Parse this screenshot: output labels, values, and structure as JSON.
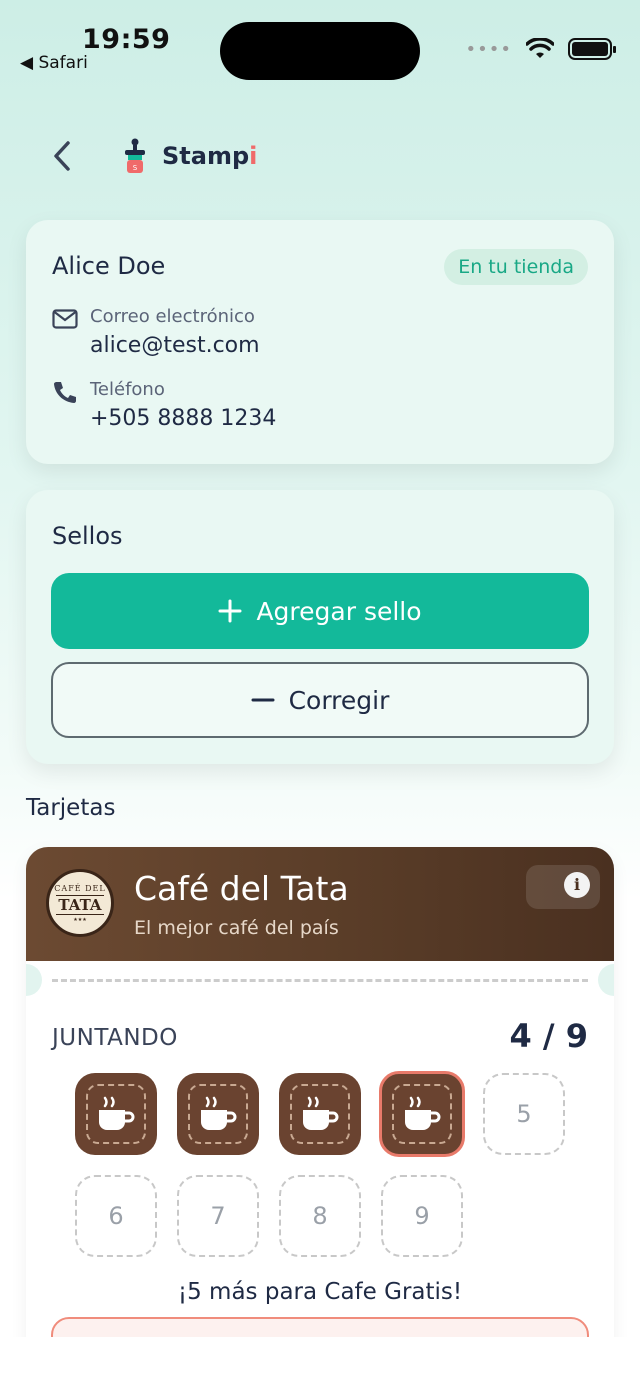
{
  "status_bar": {
    "time": "19:59",
    "back_app": "◀ Safari"
  },
  "header": {
    "brand_prefix": "Stamp",
    "brand_accent": "i"
  },
  "customer": {
    "name": "Alice Doe",
    "badge": "En tu tienda",
    "email_label": "Correo electrónico",
    "email": "alice@test.com",
    "phone_label": "Teléfono",
    "phone": "+505 8888 1234"
  },
  "stamps_panel": {
    "title": "Sellos",
    "add_label": "Agregar sello",
    "fix_label": "Corregir"
  },
  "cards_section": {
    "title": "Tarjetas"
  },
  "loyalty_card": {
    "shop_name": "Café del Tata",
    "tagline": "El mejor café del país",
    "logo_top": "CAFÉ DEL",
    "logo_main": "TATA",
    "status": "JUNTANDO",
    "progress": "4 / 9",
    "collected": 4,
    "total": 9,
    "empty_slots": [
      "5",
      "6",
      "7",
      "8",
      "9"
    ],
    "remaining_text": "¡5 más para Cafe Gratis!"
  },
  "colors": {
    "accent": "#13b99a",
    "card_brown": "#5a3d28",
    "badge_text": "#19a886",
    "latest_stamp_border": "#e87a6a"
  }
}
